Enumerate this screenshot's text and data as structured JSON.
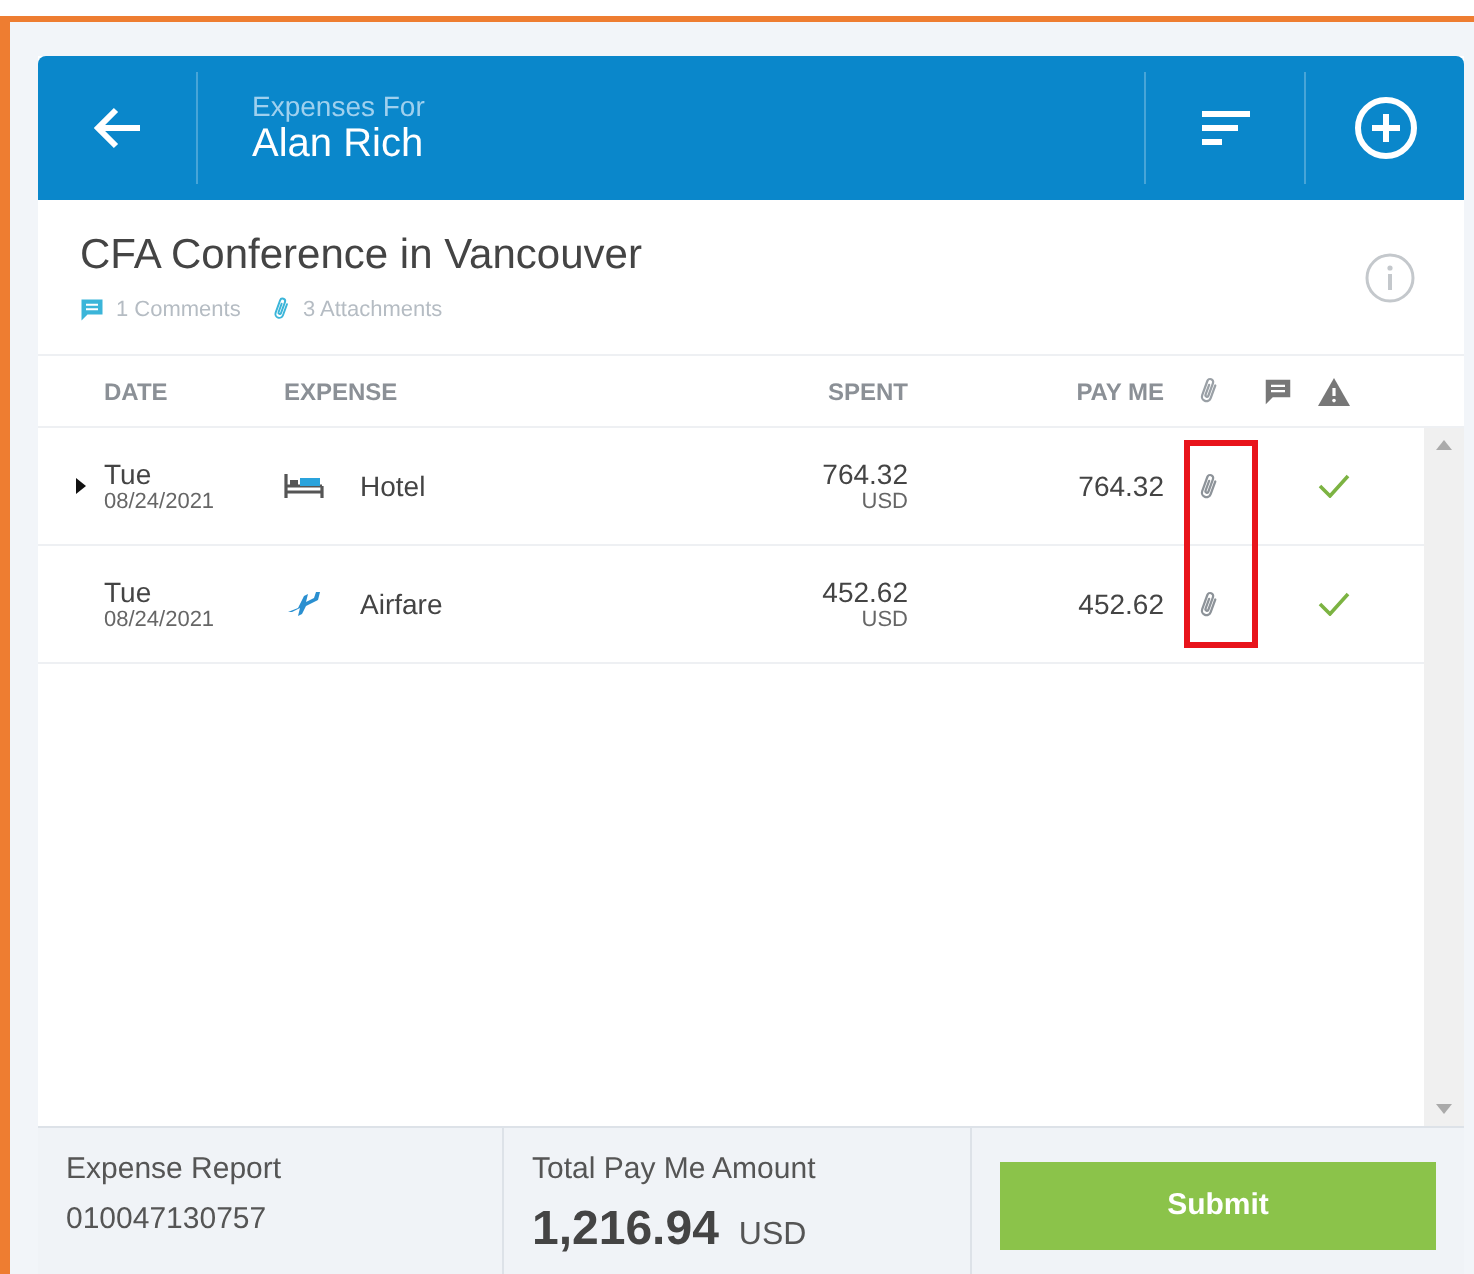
{
  "header": {
    "subtitle": "Expenses For",
    "title": "Alan Rich"
  },
  "report": {
    "title": "CFA Conference in Vancouver",
    "comments": "1 Comments",
    "attachments": "3 Attachments"
  },
  "table": {
    "columns": [
      "DATE",
      "EXPENSE",
      "SPENT",
      "PAY ME"
    ],
    "rows": [
      {
        "day": "Tue",
        "date": "08/24/2021",
        "kind": "hotel",
        "name": "Hotel",
        "spent": "764.32",
        "currency": "USD",
        "pay_me": "764.32",
        "expandable": true,
        "has_attachment": true,
        "approved": true
      },
      {
        "day": "Tue",
        "date": "08/24/2021",
        "kind": "airfare",
        "name": "Airfare",
        "spent": "452.62",
        "currency": "USD",
        "pay_me": "452.62",
        "expandable": false,
        "has_attachment": true,
        "approved": true
      }
    ]
  },
  "footer": {
    "report_label": "Expense Report",
    "report_number": "010047130757",
    "total_label": "Total Pay Me Amount",
    "total": "1,216.94",
    "total_currency": "USD",
    "submit": "Submit"
  }
}
